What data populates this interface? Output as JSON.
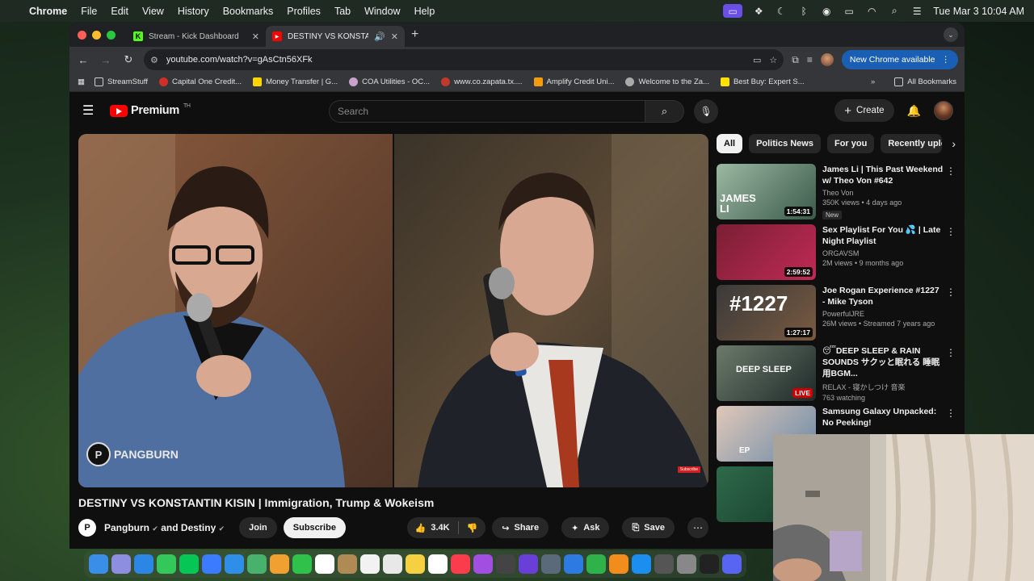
{
  "menubar": {
    "app": "Chrome",
    "items": [
      "File",
      "Edit",
      "View",
      "History",
      "Bookmarks",
      "Profiles",
      "Tab",
      "Window",
      "Help"
    ],
    "clock": "Tue Mar 3  10:04 AM"
  },
  "tabs": [
    {
      "title": "Stream - Kick Dashboard",
      "icon": "K",
      "color": "#53fc18"
    },
    {
      "title": "DESTINY VS KONSTANTIN",
      "icon": "▶",
      "color": "#ff0000"
    }
  ],
  "toolbar": {
    "url": "youtube.com/watch?v=gAsCtn56XFk",
    "new_chrome": "New Chrome available"
  },
  "bookmarks": [
    {
      "label": "StreamStuff",
      "color": "#cfcfcf"
    },
    {
      "label": "Capital One Credit...",
      "color": "#d03027"
    },
    {
      "label": "Money Transfer | G...",
      "color": "#ffd500"
    },
    {
      "label": "COA Utilities - OC...",
      "color": "#c8a2c8"
    },
    {
      "label": "www.co.zapata.tx....",
      "color": "#c0392b"
    },
    {
      "label": "Amplify Credit Uni...",
      "color": "#f39c12"
    },
    {
      "label": "Welcome to the Za...",
      "color": "#aaaaaa"
    },
    {
      "label": "Best Buy: Expert S...",
      "color": "#ffe000"
    }
  ],
  "bookmarks_all": "All Bookmarks",
  "youtube": {
    "logo": "Premium",
    "logo_sup": "TH",
    "search_placeholder": "Search",
    "create": "Create",
    "video_title": "DESTINY VS KONSTANTIN KISIN | Immigration, Trump & Wokeism",
    "watermark": "PANGBURN",
    "channel": "Pangburn",
    "channel_and": "and Destiny",
    "join": "Join",
    "subscribe": "Subscribe",
    "likes": "3.4K",
    "share": "Share",
    "ask": "Ask",
    "save": "Save",
    "chips": [
      "All",
      "Politics News",
      "For you",
      "Recently uploaded"
    ],
    "recs": [
      {
        "title": "James Li | This Past Weekend w/ Theo Von #642",
        "channel": "Theo Von",
        "stats": "350K views • 4 days ago",
        "badge": "New",
        "duration": "1:54:31",
        "thumb_text": "JAMES LI"
      },
      {
        "title": "Sex Playlist For You 💦 | Late Night Playlist",
        "channel": "ORGAVSM",
        "stats": "2M views • 9 months ago",
        "duration": "2:59:52"
      },
      {
        "title": "Joe Rogan Experience #1227 - Mike Tyson",
        "channel": "PowerfulJRE",
        "stats": "26M views • Streamed 7 years ago",
        "duration": "1:27:17",
        "thumb_text": "#1227"
      },
      {
        "title": "😴DEEP SLEEP & RAIN SOUNDS サクッと眠れる 睡眠用BGM...",
        "channel": "RELAX - 寝かしつけ 音楽",
        "stats": "763 watching",
        "duration": "LIVE",
        "thumb_text": "DEEP SLEEP"
      },
      {
        "title": "Samsung Galaxy Unpacked: No Peeking!",
        "channel": "",
        "stats": "",
        "duration": "",
        "thumb_text": "EP"
      }
    ]
  },
  "dock_apps": [
    {
      "name": "finder",
      "color": "#3b8ee8"
    },
    {
      "name": "launchpad",
      "color": "#8e8ee0"
    },
    {
      "name": "safari",
      "color": "#2b86e6"
    },
    {
      "name": "messages",
      "color": "#34c759"
    },
    {
      "name": "line",
      "color": "#06c755"
    },
    {
      "name": "messenger",
      "color": "#3a7bff"
    },
    {
      "name": "mail",
      "color": "#2f8fe8"
    },
    {
      "name": "maps",
      "color": "#48b26c"
    },
    {
      "name": "photos",
      "color": "#f0a030"
    },
    {
      "name": "facetime",
      "color": "#2fc14a"
    },
    {
      "name": "calendar",
      "color": "#ffffff"
    },
    {
      "name": "notes-brown",
      "color": "#b08a55"
    },
    {
      "name": "reminders",
      "color": "#f2f2f2"
    },
    {
      "name": "chrome",
      "color": "#e8e8e8"
    },
    {
      "name": "notes",
      "color": "#f5d142"
    },
    {
      "name": "freeform",
      "color": "#ffffff"
    },
    {
      "name": "music",
      "color": "#fa3c4c"
    },
    {
      "name": "podcasts",
      "color": "#a24ee0"
    },
    {
      "name": "activity",
      "color": "#444444"
    },
    {
      "name": "imovie",
      "color": "#6a3fd8"
    },
    {
      "name": "preview",
      "color": "#5a6a7a"
    },
    {
      "name": "keynote",
      "color": "#2d7be0"
    },
    {
      "name": "numbers",
      "color": "#2fb24a"
    },
    {
      "name": "pages",
      "color": "#f28c1c"
    },
    {
      "name": "appstore",
      "color": "#1c8ef0"
    },
    {
      "name": "calculator",
      "color": "#555555"
    },
    {
      "name": "settings",
      "color": "#888888"
    },
    {
      "name": "obs",
      "color": "#222222"
    },
    {
      "name": "discord",
      "color": "#5865f2"
    }
  ]
}
